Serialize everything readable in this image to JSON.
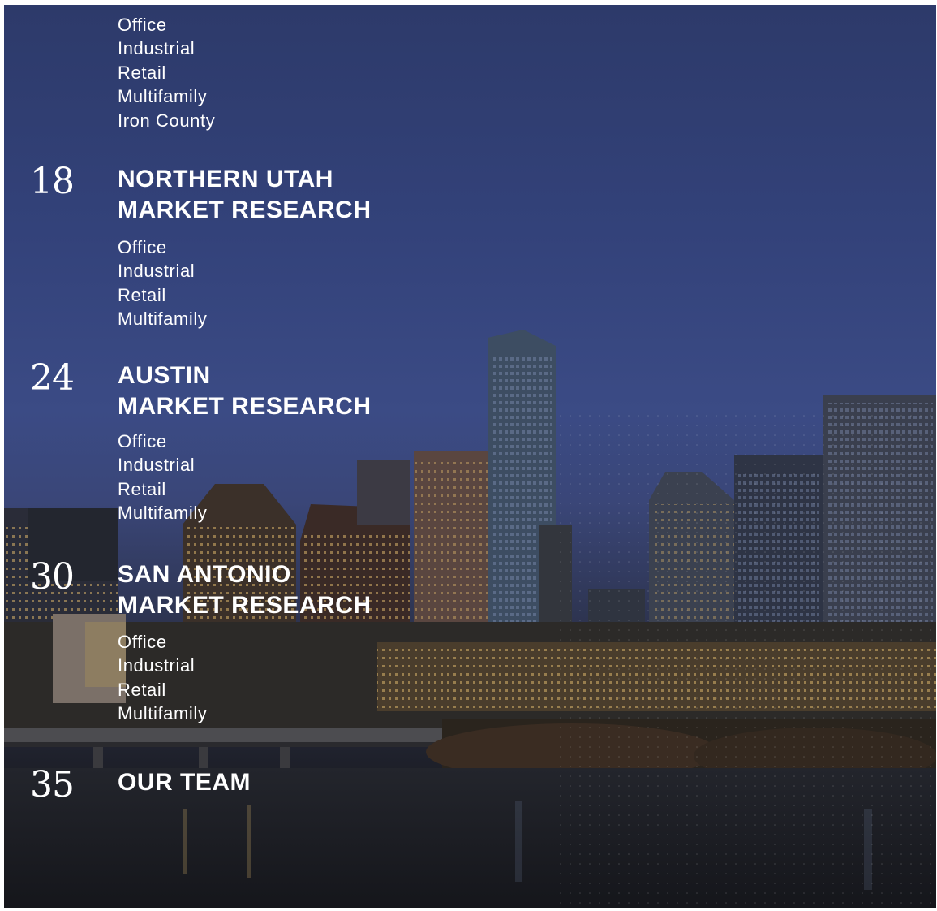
{
  "top_items": [
    "Office",
    "Industrial",
    "Retail",
    "Multifamily",
    "Iron County"
  ],
  "sections": [
    {
      "page": "18",
      "title_line1": "NORTHERN UTAH",
      "title_line2": "MARKET RESEARCH",
      "items": [
        "Office",
        "Industrial",
        "Retail",
        "Multifamily"
      ]
    },
    {
      "page": "24",
      "title_line1": "AUSTIN",
      "title_line2": "MARKET RESEARCH",
      "items": [
        "Office",
        "Industrial",
        "Retail",
        "Multifamily"
      ]
    },
    {
      "page": "30",
      "title_line1": "SAN ANTONIO",
      "title_line2": "MARKET RESEARCH",
      "items": [
        "Office",
        "Industrial",
        "Retail",
        "Multifamily"
      ]
    },
    {
      "page": "35",
      "title_line1": "OUR TEAM"
    }
  ],
  "colors": {
    "sky_top": "#2d3a6a",
    "sky_mid": "#3b4b85",
    "text": "#ffffff"
  },
  "background_image": "city-skyline-at-dusk"
}
